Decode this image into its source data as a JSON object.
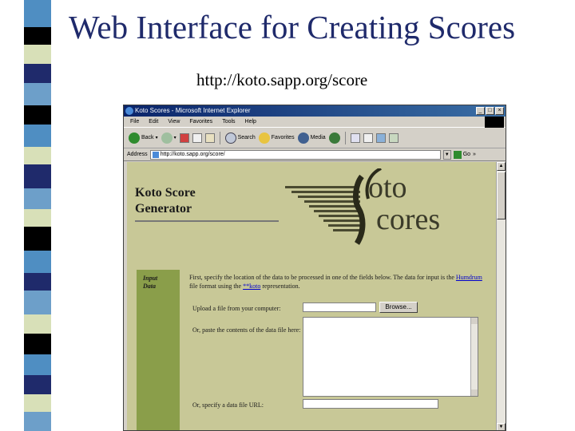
{
  "slide": {
    "title": "Web Interface for Creating Scores",
    "url": "http://koto.sapp.org/score"
  },
  "strip_colors": [
    "#4f8ec2",
    "#000000",
    "#d8e0b8",
    "#1f2a6b",
    "#6d9fc9"
  ],
  "browser": {
    "window_title": "Koto Scores - Microsoft Internet Explorer",
    "menu": [
      "File",
      "Edit",
      "View",
      "Favorites",
      "Tools",
      "Help"
    ],
    "toolbar": {
      "back": "Back",
      "search": "Search",
      "favorites": "Favorites",
      "media": "Media"
    },
    "address": {
      "label": "Address",
      "value": "http://koto.sapp.org/score/",
      "go": "Go",
      "links": "»"
    }
  },
  "page": {
    "title_line1": "Koto Score",
    "title_line2": "Generator",
    "logo_top": "oto",
    "logo_bottom": "cores",
    "section_line1": "Input",
    "section_line2": "Data",
    "intro_part1": "First, specify the location of the data to be processed in one of the fields below. The data for input is the ",
    "intro_link1": "Humdrum",
    "intro_part2": " file format using the ",
    "intro_link2": "**koto",
    "intro_part3": " representation.",
    "upload_label": "Upload a file from your computer:",
    "browse_label": "Browse...",
    "paste_label": "Or, paste the contents of the data file here:",
    "url_label": "Or, specify a data file URL:"
  },
  "colors": {
    "page_bg": "#c8c897",
    "sidebar_bg": "#8a9e4a",
    "title_color": "#1f2a6b"
  }
}
